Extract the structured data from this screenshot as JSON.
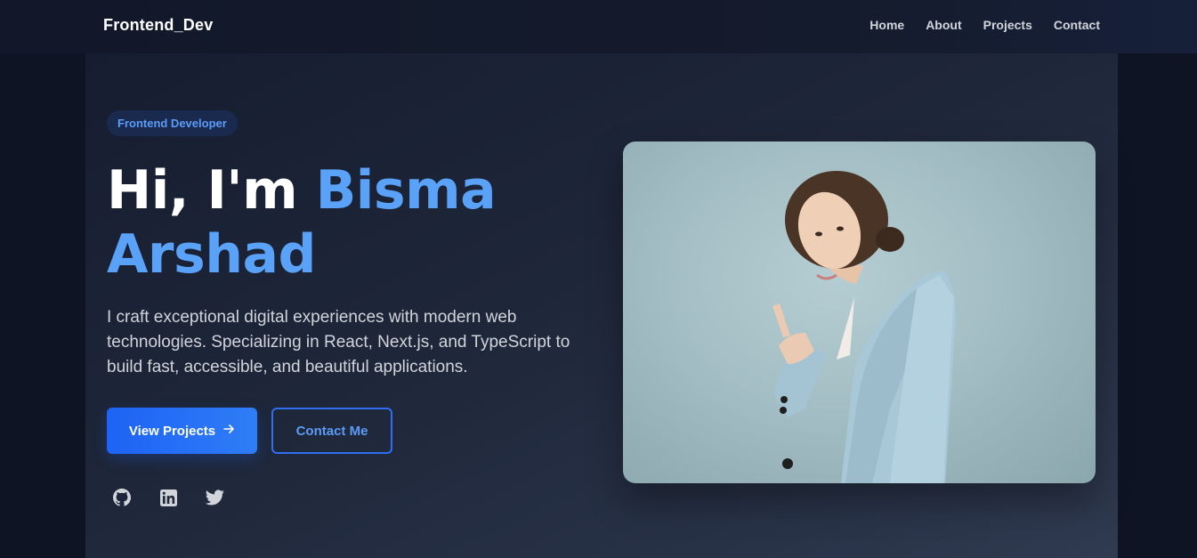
{
  "nav": {
    "brand": "Frontend_Dev",
    "links": [
      "Home",
      "About",
      "Projects",
      "Contact"
    ]
  },
  "hero": {
    "badge": "Frontend Developer",
    "greeting": "Hi, I'm ",
    "name": "Bisma Arshad",
    "description": "I craft exceptional digital experiences with modern web technologies. Specializing in React, Next.js, and TypeScript to build fast, accessible, and beautiful applications.",
    "primary_button": "View Projects",
    "secondary_button": "Contact Me",
    "socials": [
      "github-icon",
      "linkedin-icon",
      "twitter-icon"
    ]
  },
  "colors": {
    "accent": "#5aa2f8",
    "primary": "#1d63f5",
    "background": "#0f1424"
  }
}
